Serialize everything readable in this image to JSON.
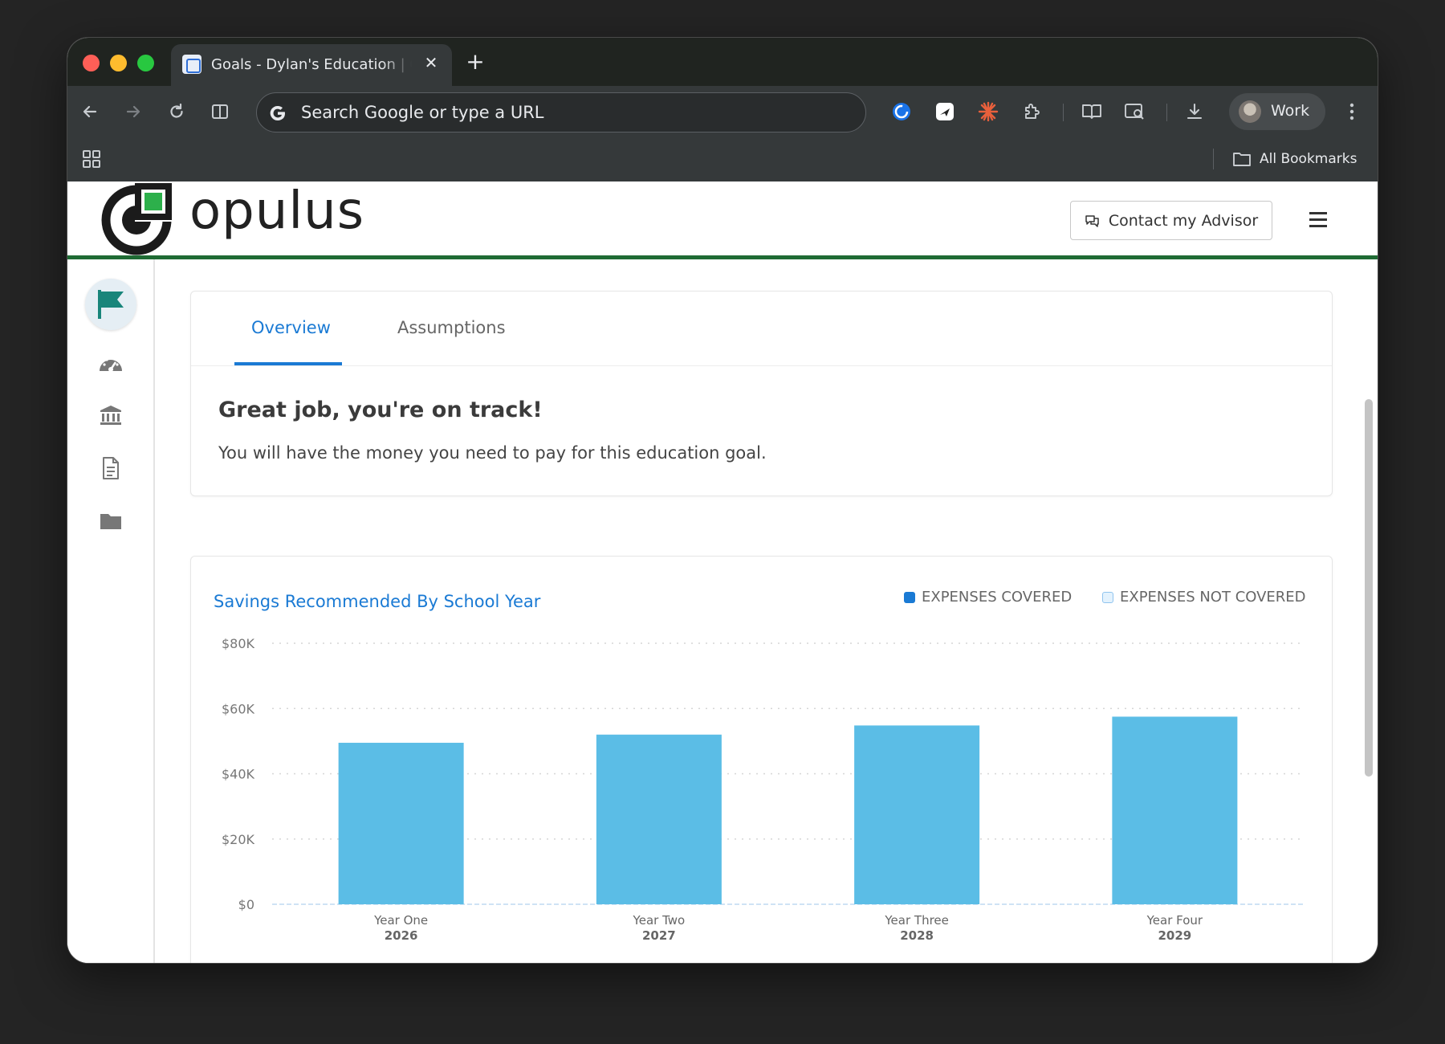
{
  "browser": {
    "tab_title": "Goals - Dylan's Education | Opulus",
    "omnibox_placeholder": "Search Google or type a URL",
    "profile_label": "Work",
    "bookmarks_label": "All Bookmarks"
  },
  "site": {
    "logo_text": "opulus",
    "contact_label": "Contact my Advisor"
  },
  "tabs": [
    {
      "label": "Overview"
    },
    {
      "label": "Assumptions"
    }
  ],
  "status": {
    "title": "Great job, you're on track!",
    "description": "You will have the money you need to pay for this education goal."
  },
  "chart_data": {
    "type": "bar",
    "title": "Savings Recommended By School Year",
    "categories": [
      "Year One",
      "Year Two",
      "Year Three",
      "Year Four"
    ],
    "category_years": [
      "2026",
      "2027",
      "2028",
      "2029"
    ],
    "series": [
      {
        "name": "EXPENSES COVERED",
        "values": [
          49500,
          52000,
          54800,
          57500
        ],
        "color": "#5bbde6"
      },
      {
        "name": "EXPENSES NOT COVERED",
        "values": [
          0,
          0,
          0,
          0
        ],
        "color": "#e3f2fd"
      }
    ],
    "ylim": [
      0,
      80000
    ],
    "yticks": [
      "$0",
      "$20K",
      "$40K",
      "$60K",
      "$80K"
    ],
    "legend_position": "top-right",
    "grid": true
  },
  "colors": {
    "accent": "#1a7ad4",
    "brand_green": "#1f6b34",
    "bar": "#5bbde6",
    "legend_covered": "#1a7ad4"
  }
}
